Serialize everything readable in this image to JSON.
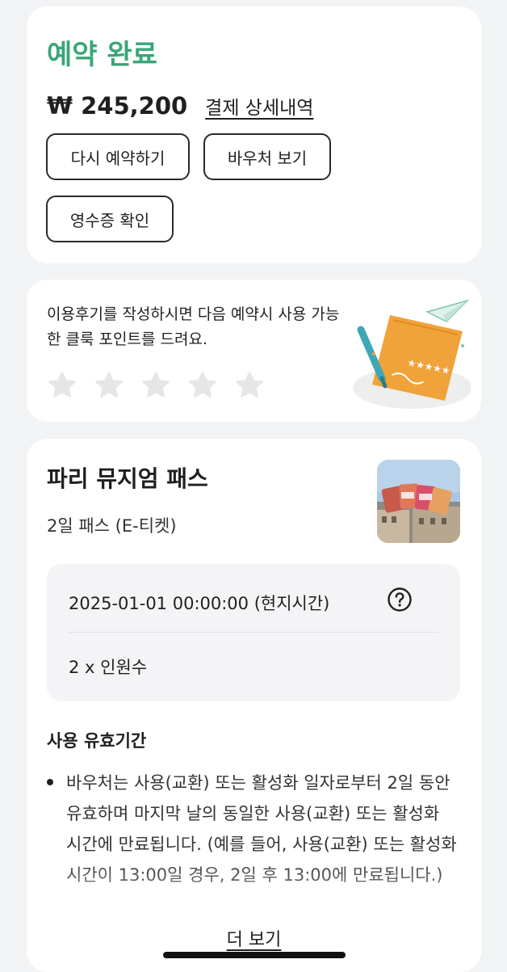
{
  "booking": {
    "status": "예약 완료",
    "price": "₩ 245,200",
    "payment_detail_link": "결제 상세내역",
    "buttons": {
      "rebook": "다시 예약하기",
      "voucher": "바우처 보기",
      "receipt": "영수증 확인"
    }
  },
  "review": {
    "prompt": "이용후기를 작성하시면 다음 예약시 사용 가능한 클룩 포인트를 드려요.",
    "rating": 0,
    "max_rating": 5,
    "illustration": "review-paper-plane-illustration"
  },
  "product": {
    "title": "파리 뮤지엄 패스",
    "option": "2일 패스 (E-티켓)",
    "thumbnail": "paris-museum-pass-photo",
    "datetime": "2025-01-01 00:00:00 (현지시간)",
    "help_icon": "question-circle-icon",
    "participants": "2 x 인원수",
    "validity": {
      "title": "사용 유효기간",
      "items": [
        "바우처는 사용(교환) 또는 활성화 일자로부터 2일 동안 유효하며 마지막 날의 동일한 사용(교환) 또는 활성화 시간에 만료됩니다. (예를 들어, 사용(교환) 또는 활성화 시간이 13:00일 경우, 2일 후 13:00에 만료됩니다.)"
      ]
    },
    "more_link": "더 보기"
  },
  "colors": {
    "accent_green": "#3aa57a",
    "page_bg": "#f2f3f5",
    "star_inactive": "#e6e6e8"
  }
}
